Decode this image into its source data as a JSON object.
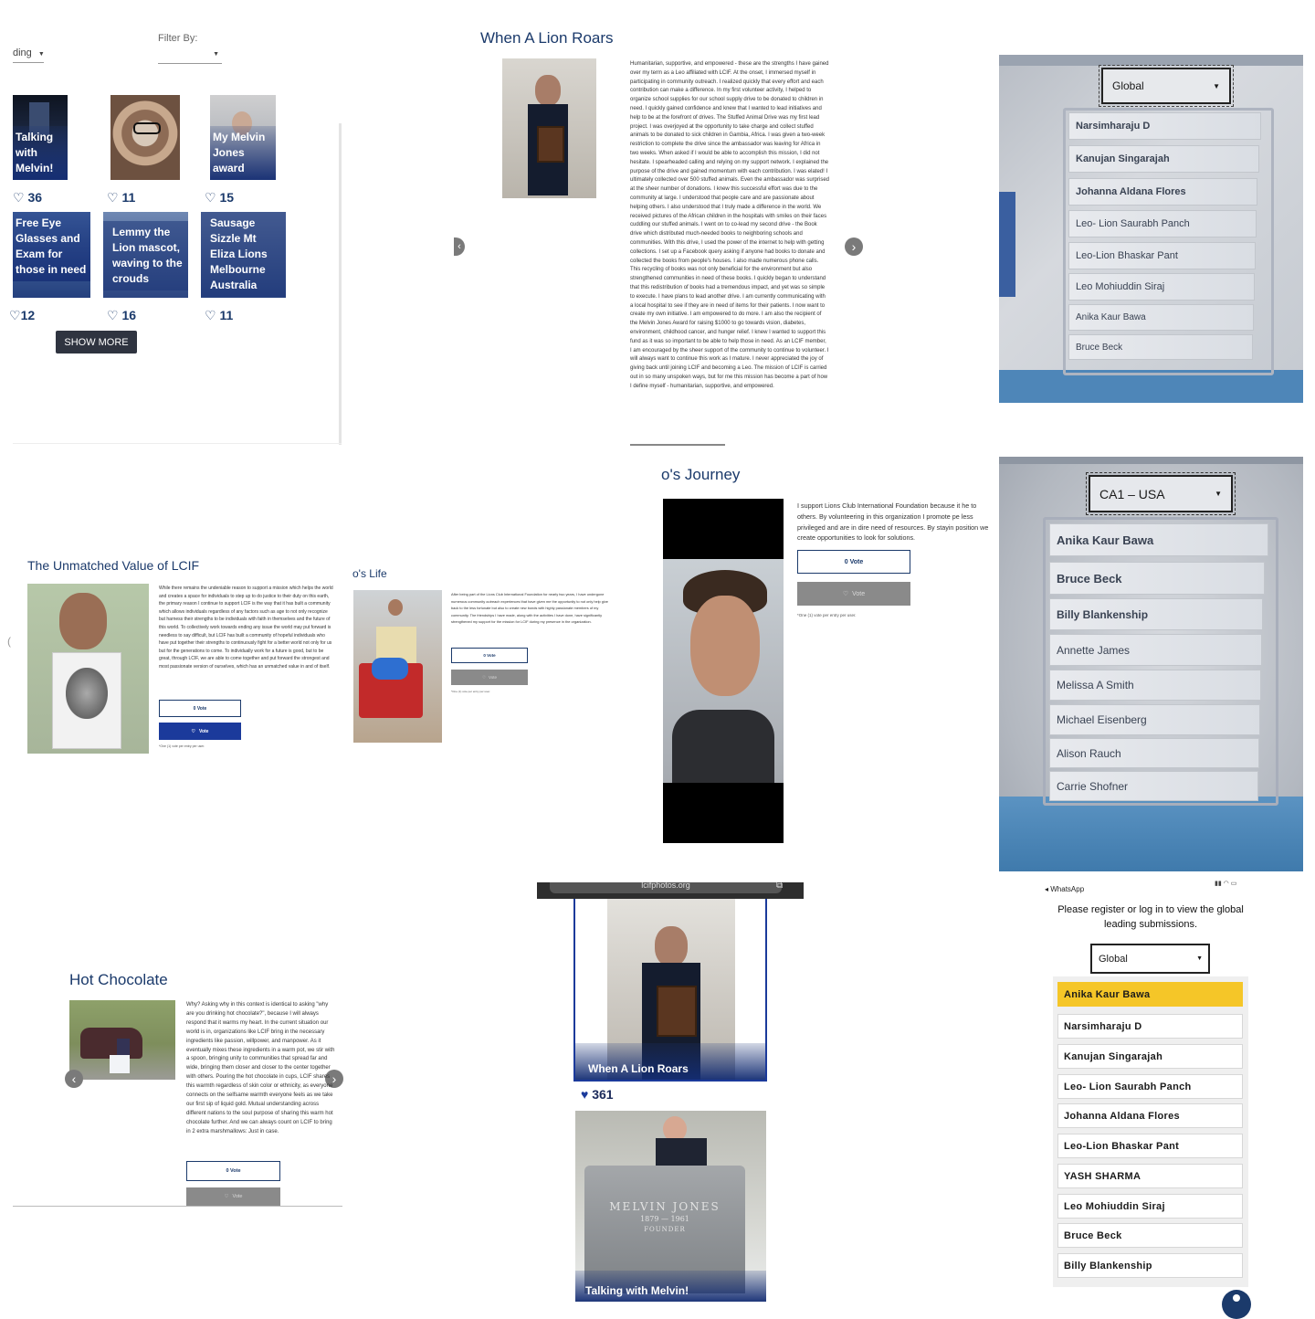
{
  "panel_gallery": {
    "sort_label_partial": "ding",
    "filter_label": "Filter By:",
    "cards": [
      {
        "caption": "Talking with Melvin!",
        "likes": "36"
      },
      {
        "caption": "",
        "likes": "11"
      },
      {
        "caption": "My Melvin Jones award",
        "likes": "15"
      },
      {
        "caption": "Free Eye Glasses and Exam for those in need",
        "likes": "12"
      },
      {
        "caption": "Lemmy the Lion mascot, waving to the crouds",
        "likes": "16"
      },
      {
        "caption": "Sausage Sizzle Mt Eliza Lions Melbourne Australia",
        "likes": "11"
      }
    ],
    "show_more": "SHOW MORE"
  },
  "panel_lion_roars": {
    "title": "When A Lion Roars",
    "body": "Humanitarian, supportive, and empowered - these are the strengths I have gained over my term as a Leo affiliated with LCIF. At the onset, I immersed myself in participating in community outreach. I realized quickly that every effort and each contribution can make a difference. In my first volunteer activity, I helped to organize school supplies for our school supply drive to be donated to children in need. I quickly gained confidence and knew that I wanted to lead initiatives and help to be at the forefront of drives. The Stuffed Animal Drive was my first lead project. I was overjoyed at the opportunity to take charge and collect stuffed animals to be donated to sick children in Gambia, Africa. I was given a two-week restriction to complete the drive since the ambassador was leaving for Africa in two weeks. When asked if I would be able to accomplish this mission, I did not hesitate. I spearheaded calling and relying on my support network. I explained the purpose of the drive and gained momentum with each contribution. I was elated! I ultimately collected over 500 stuffed animals. Even the ambassador was surprised at the sheer number of donations. I knew this successful effort was due to the community at large. I understood that people care and are passionate about helping others. I also understood that I truly made a difference in the world. We received pictures of the African children in the hospitals with smiles on their faces cuddling our stuffed animals. I went on to co-lead my second drive - the Book drive which distributed much-needed books to neighboring schools and communities. With this drive, I used the power of the internet to help with getting collections. I set up a Facebook query asking if anyone had books to donate and collected the books from people's houses. I also made numerous phone calls. This recycling of books was not only beneficial for the environment but also strengthened communities in need of these books. I quickly began to understand that this redistribution of books had a tremendous impact, and yet was so simple to execute. I have plans to lead another drive. I am currently communicating with a local hospital to see if they are in need of items for their patients. I now want to create my own initiative. I am empowered to do more. I am also the recipient of the Melvin Jones Award for raising $1000 to go towards vision, diabetes, environment, childhood cancer, and hunger relief. I knew I wanted to support this fund as it was so important to be able to help those in need. As an LCIF member, I am encouraged by the sheer support of the community to continue to volunteer. I will always want to continue this work as I mature. I never appreciated the joy of giving back until joining LCIF and becoming a Leo. The mission of LCIF is carried out in so many unspoken ways, but for me this mission has become a part of how I define myself - humanitarian, supportive, and empowered."
  },
  "panel_global_photo": {
    "select": "Global",
    "items": [
      "Narsimharaju D",
      "Kanujan Singarajah",
      "Johanna Aldana Flores",
      "Leo- Lion Saurabh Panch",
      "Leo-Lion Bhaskar Pant",
      "Leo Mohiuddin Siraj",
      "Anika Kaur Bawa",
      "Bruce Beck"
    ]
  },
  "panel_unmatched": {
    "title": "The Unmatched Value of LCIF",
    "body": "While there remains the undeniable reason to support a mission which helps the world and creates a space for individuals to step up to do justice to their duty on this earth, the primary reason I continue to support LCIF is the way that it has built a community which allows individuals regardless of any factors such as age to not only recognize but harness their strengths to be individuals with faith in themselves and the future of this world. To collectively work towards ending any issue the world may put forward is needless to say difficult, but LCIF has built a community of hopeful individuals who have put together their strengths to continuously fight for a better world not only for us but for the generations to come. To individually work for a future is good, but to be great, through LCIF, we are able to come together and put forward the strongest and most passionate version of ourselves, which has an unmatched value in and of itself.",
    "vote_count": "0 Vote",
    "vote": "Vote",
    "note": "*One (1) vote per entry per user."
  },
  "panel_life": {
    "title_partial": "o's Life",
    "body": "After being part of the Lions Club International Foundation for nearly two years, I have undergone numerous community outreach experiences that have given me the opportunity to not only help give back to the less fortunate but also to create new bonds with highly passionate members of my community. The friendships I have made, along with the activities I have done, have significantly strengthened my support for the mission for LCIF during my presence in the organization.",
    "vote_count": "0 Vote",
    "vote": "Vote",
    "note": "*One (1) vote per entry per user."
  },
  "panel_journey": {
    "title_partial": "o's Journey",
    "body": "I support Lions Club International Foundation because it he to others. By volunteering in this organization I promote pe less privileged and are in dire need of resources. By stayin position we create opportunities to look for solutions.",
    "vote_count": "0 Vote",
    "vote": "Vote",
    "note": "*One (1) vote per entry per user."
  },
  "panel_ca1_photo": {
    "select": "CA1 – USA",
    "items": [
      "Anika Kaur Bawa",
      "Bruce Beck",
      "Billy Blankenship",
      "Annette James",
      "Melissa A Smith",
      "Michael Eisenberg",
      "Alison Rauch",
      "Carrie Shofner"
    ]
  },
  "panel_hot_chocolate": {
    "title": "Hot Chocolate",
    "body": "Why? Asking why in this context is identical to asking \"why are you drinking hot chocolate?\", because I will always respond that it warms my heart. In the current situation our world is in, organizations like LCIF bring in the necessary ingredients like passion, willpower, and manpower. As it eventually mixes these ingredients in a warm pot, we stir with a spoon, bringing unity to communities that spread far and wide, bringing them closer and closer to the center together with others. Pouring the hot chocolate in cups, LCIF shares this warmth regardless of skin color or ethnicity, as everyone connects on the selfsame warmth everyone feels as we take our first sip of liquid gold. Mutual understanding across different nations to the soul purpose of sharing this warm hot chocolate further. And we can always count on LCIF to bring in 2 extra marshmallows: Just in case.",
    "vote_count": "0 Vote",
    "vote": "Vote"
  },
  "panel_mobile_cards": {
    "url_bar": "lcifphotos.org",
    "card1_caption": "When A Lion Roars",
    "card1_likes": "361",
    "card2_caption": "Talking with Melvin!",
    "headstone_line1": "MELVIN JONES",
    "headstone_line2": "1879 — 1961",
    "headstone_line3": "FOUNDER"
  },
  "panel_leaderboard": {
    "back_label": "◂ WhatsApp",
    "message": "Please register or log in to view the global leading submissions.",
    "select": "Global",
    "items": [
      "Anika Kaur Bawa",
      "Narsimharaju D",
      "Kanujan Singarajah",
      "Leo- Lion Saurabh Panch",
      "Johanna Aldana Flores",
      "Leo-Lion Bhaskar Pant",
      "YASH SHARMA",
      "Leo Mohiuddin Siraj",
      "Bruce Beck",
      "Billy Blankenship"
    ],
    "highlight_color": "#f5c628"
  }
}
